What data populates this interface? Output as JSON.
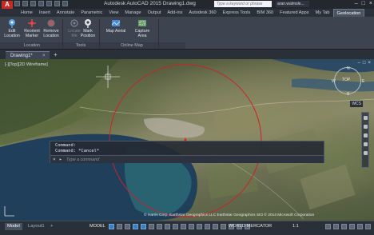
{
  "titlebar": {
    "title": "Autodesk AutoCAD 2015    Drawing1.dwg",
    "search_placeholder": "Type a keyword or phrase",
    "user": "aran.walmsle...",
    "controls": [
      "–",
      "□",
      "×"
    ]
  },
  "ribbon": {
    "tabs": [
      "Home",
      "Insert",
      "Annotate",
      "Parametric",
      "View",
      "Manage",
      "Output",
      "Add-ins",
      "Autodesk 360",
      "Express Tools",
      "BIM 360",
      "Featured Apps",
      "My Tab",
      "Geolocation"
    ],
    "active_tab": "Geolocation",
    "buttons": {
      "edit_location": "Edit Location",
      "reorient_marker": "Reorient Marker",
      "remove_location": "Remove Location",
      "locate_me": "Locate Me",
      "mark_position": "Mark Position",
      "map_aerial": "Map Aerial",
      "capture_area": "Capture Area"
    },
    "panels": [
      "Location",
      "Tools",
      "Online Map"
    ]
  },
  "doc_tabs": {
    "active": "Drawing1*",
    "close": "×",
    "add": "+"
  },
  "viewport": {
    "label": "[-][Top][2D Wireframe]",
    "controls": [
      "–",
      "□",
      "×"
    ],
    "viewcube": {
      "n": "N",
      "s": "S",
      "e": "E",
      "w": "W",
      "face": "TOP"
    },
    "wcs": "WCS",
    "copyright": "© Harris Corp, Earthstar Geographics LLC Earthstar Geographics SIO © 2014 Microsoft Corporation"
  },
  "command": {
    "history": [
      "Command:",
      "Command: *Cancel*"
    ],
    "prompt": "Type a command",
    "close_icon": "×",
    "arrow_icon": "▸"
  },
  "statusbar": {
    "layout_tabs": [
      "Model",
      "Layout1",
      "+"
    ],
    "model_label": "MODEL",
    "coord_system": "WORLD-MERCATOR",
    "scale": "1:1"
  },
  "colors": {
    "marker_red": "#d8282e",
    "circle_red": "#c9232b",
    "accent_blue": "#3a7fc1"
  }
}
